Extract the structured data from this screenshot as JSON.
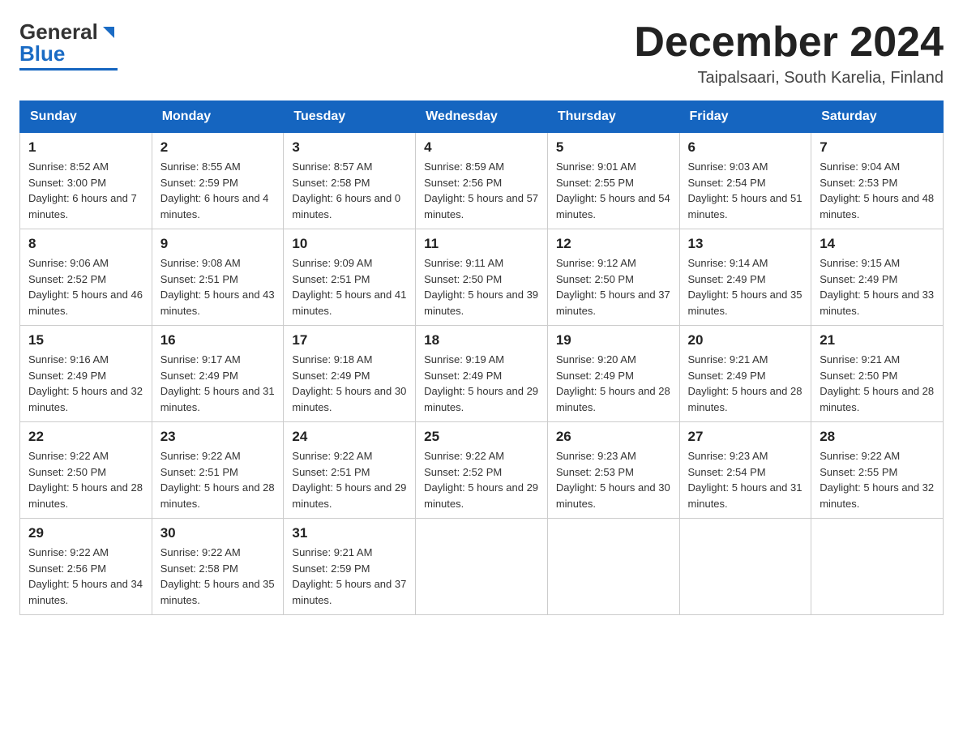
{
  "header": {
    "logo_general": "General",
    "logo_blue": "Blue",
    "title": "December 2024",
    "subtitle": "Taipalsaari, South Karelia, Finland"
  },
  "days_of_week": [
    "Sunday",
    "Monday",
    "Tuesday",
    "Wednesday",
    "Thursday",
    "Friday",
    "Saturday"
  ],
  "weeks": [
    [
      {
        "day": "1",
        "sunrise": "8:52 AM",
        "sunset": "3:00 PM",
        "daylight": "6 hours and 7 minutes."
      },
      {
        "day": "2",
        "sunrise": "8:55 AM",
        "sunset": "2:59 PM",
        "daylight": "6 hours and 4 minutes."
      },
      {
        "day": "3",
        "sunrise": "8:57 AM",
        "sunset": "2:58 PM",
        "daylight": "6 hours and 0 minutes."
      },
      {
        "day": "4",
        "sunrise": "8:59 AM",
        "sunset": "2:56 PM",
        "daylight": "5 hours and 57 minutes."
      },
      {
        "day": "5",
        "sunrise": "9:01 AM",
        "sunset": "2:55 PM",
        "daylight": "5 hours and 54 minutes."
      },
      {
        "day": "6",
        "sunrise": "9:03 AM",
        "sunset": "2:54 PM",
        "daylight": "5 hours and 51 minutes."
      },
      {
        "day": "7",
        "sunrise": "9:04 AM",
        "sunset": "2:53 PM",
        "daylight": "5 hours and 48 minutes."
      }
    ],
    [
      {
        "day": "8",
        "sunrise": "9:06 AM",
        "sunset": "2:52 PM",
        "daylight": "5 hours and 46 minutes."
      },
      {
        "day": "9",
        "sunrise": "9:08 AM",
        "sunset": "2:51 PM",
        "daylight": "5 hours and 43 minutes."
      },
      {
        "day": "10",
        "sunrise": "9:09 AM",
        "sunset": "2:51 PM",
        "daylight": "5 hours and 41 minutes."
      },
      {
        "day": "11",
        "sunrise": "9:11 AM",
        "sunset": "2:50 PM",
        "daylight": "5 hours and 39 minutes."
      },
      {
        "day": "12",
        "sunrise": "9:12 AM",
        "sunset": "2:50 PM",
        "daylight": "5 hours and 37 minutes."
      },
      {
        "day": "13",
        "sunrise": "9:14 AM",
        "sunset": "2:49 PM",
        "daylight": "5 hours and 35 minutes."
      },
      {
        "day": "14",
        "sunrise": "9:15 AM",
        "sunset": "2:49 PM",
        "daylight": "5 hours and 33 minutes."
      }
    ],
    [
      {
        "day": "15",
        "sunrise": "9:16 AM",
        "sunset": "2:49 PM",
        "daylight": "5 hours and 32 minutes."
      },
      {
        "day": "16",
        "sunrise": "9:17 AM",
        "sunset": "2:49 PM",
        "daylight": "5 hours and 31 minutes."
      },
      {
        "day": "17",
        "sunrise": "9:18 AM",
        "sunset": "2:49 PM",
        "daylight": "5 hours and 30 minutes."
      },
      {
        "day": "18",
        "sunrise": "9:19 AM",
        "sunset": "2:49 PM",
        "daylight": "5 hours and 29 minutes."
      },
      {
        "day": "19",
        "sunrise": "9:20 AM",
        "sunset": "2:49 PM",
        "daylight": "5 hours and 28 minutes."
      },
      {
        "day": "20",
        "sunrise": "9:21 AM",
        "sunset": "2:49 PM",
        "daylight": "5 hours and 28 minutes."
      },
      {
        "day": "21",
        "sunrise": "9:21 AM",
        "sunset": "2:50 PM",
        "daylight": "5 hours and 28 minutes."
      }
    ],
    [
      {
        "day": "22",
        "sunrise": "9:22 AM",
        "sunset": "2:50 PM",
        "daylight": "5 hours and 28 minutes."
      },
      {
        "day": "23",
        "sunrise": "9:22 AM",
        "sunset": "2:51 PM",
        "daylight": "5 hours and 28 minutes."
      },
      {
        "day": "24",
        "sunrise": "9:22 AM",
        "sunset": "2:51 PM",
        "daylight": "5 hours and 29 minutes."
      },
      {
        "day": "25",
        "sunrise": "9:22 AM",
        "sunset": "2:52 PM",
        "daylight": "5 hours and 29 minutes."
      },
      {
        "day": "26",
        "sunrise": "9:23 AM",
        "sunset": "2:53 PM",
        "daylight": "5 hours and 30 minutes."
      },
      {
        "day": "27",
        "sunrise": "9:23 AM",
        "sunset": "2:54 PM",
        "daylight": "5 hours and 31 minutes."
      },
      {
        "day": "28",
        "sunrise": "9:22 AM",
        "sunset": "2:55 PM",
        "daylight": "5 hours and 32 minutes."
      }
    ],
    [
      {
        "day": "29",
        "sunrise": "9:22 AM",
        "sunset": "2:56 PM",
        "daylight": "5 hours and 34 minutes."
      },
      {
        "day": "30",
        "sunrise": "9:22 AM",
        "sunset": "2:58 PM",
        "daylight": "5 hours and 35 minutes."
      },
      {
        "day": "31",
        "sunrise": "9:21 AM",
        "sunset": "2:59 PM",
        "daylight": "5 hours and 37 minutes."
      },
      null,
      null,
      null,
      null
    ]
  ],
  "labels": {
    "sunrise": "Sunrise:",
    "sunset": "Sunset:",
    "daylight": "Daylight:"
  }
}
